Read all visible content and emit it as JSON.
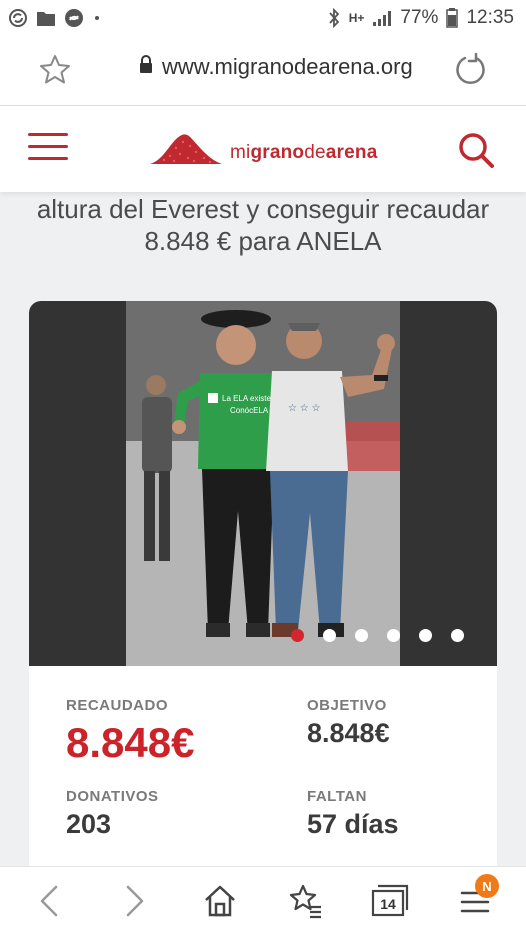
{
  "status_bar": {
    "battery": "77%",
    "time": "12:35",
    "network": "H+"
  },
  "browser": {
    "url": "www.migranodearena.org",
    "tab_count": "14",
    "menu_badge": "N"
  },
  "site": {
    "logo_mi": "mi",
    "logo_grano": "grano",
    "logo_de": "de",
    "logo_arena": "arena",
    "brand_color": "#c0292f"
  },
  "campaign": {
    "title": "altura del Everest y conseguir recaudar 8.848 € para ANELA"
  },
  "carousel": {
    "total_slides": 6,
    "active_slide": 1,
    "shirt_text_1": "La ELA existe",
    "shirt_text_2": "ConócELA"
  },
  "stats": {
    "raised_label": "RECAUDADO",
    "raised_value": "8.848€",
    "goal_label": "OBJETIVO",
    "goal_value": "8.848€",
    "donations_label": "DONATIVOS",
    "donations_value": "203",
    "remaining_label": "FALTAN",
    "remaining_value": "57 días"
  }
}
